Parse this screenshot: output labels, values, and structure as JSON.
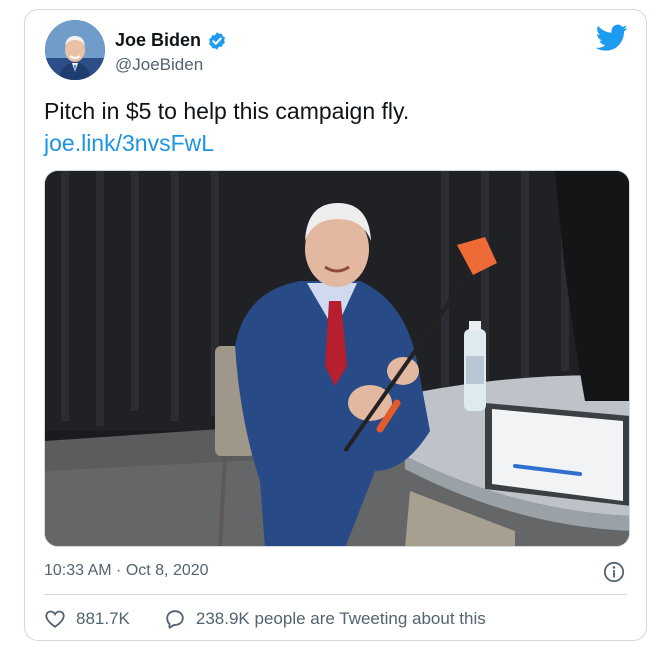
{
  "tweet": {
    "author_name": "Joe Biden",
    "handle": "@JoeBiden",
    "text": "Pitch in $5 to help this campaign fly.",
    "link_text": "joe.link/3nvsFwL",
    "timestamp": "10:33 AM · Oct 8, 2020",
    "likes": "881.7K",
    "retweets_text": "238.9K people are Tweeting about this"
  },
  "colors": {
    "brand": "#1d9bf0",
    "link": "#1b95e0",
    "secondary_text": "#536471",
    "border": "#cfd9de"
  },
  "icons": {
    "verified": "verified-badge-icon",
    "brand": "twitter-bird-icon",
    "info": "info-icon",
    "like": "heart-icon",
    "reply": "speech-bubble-icon"
  }
}
